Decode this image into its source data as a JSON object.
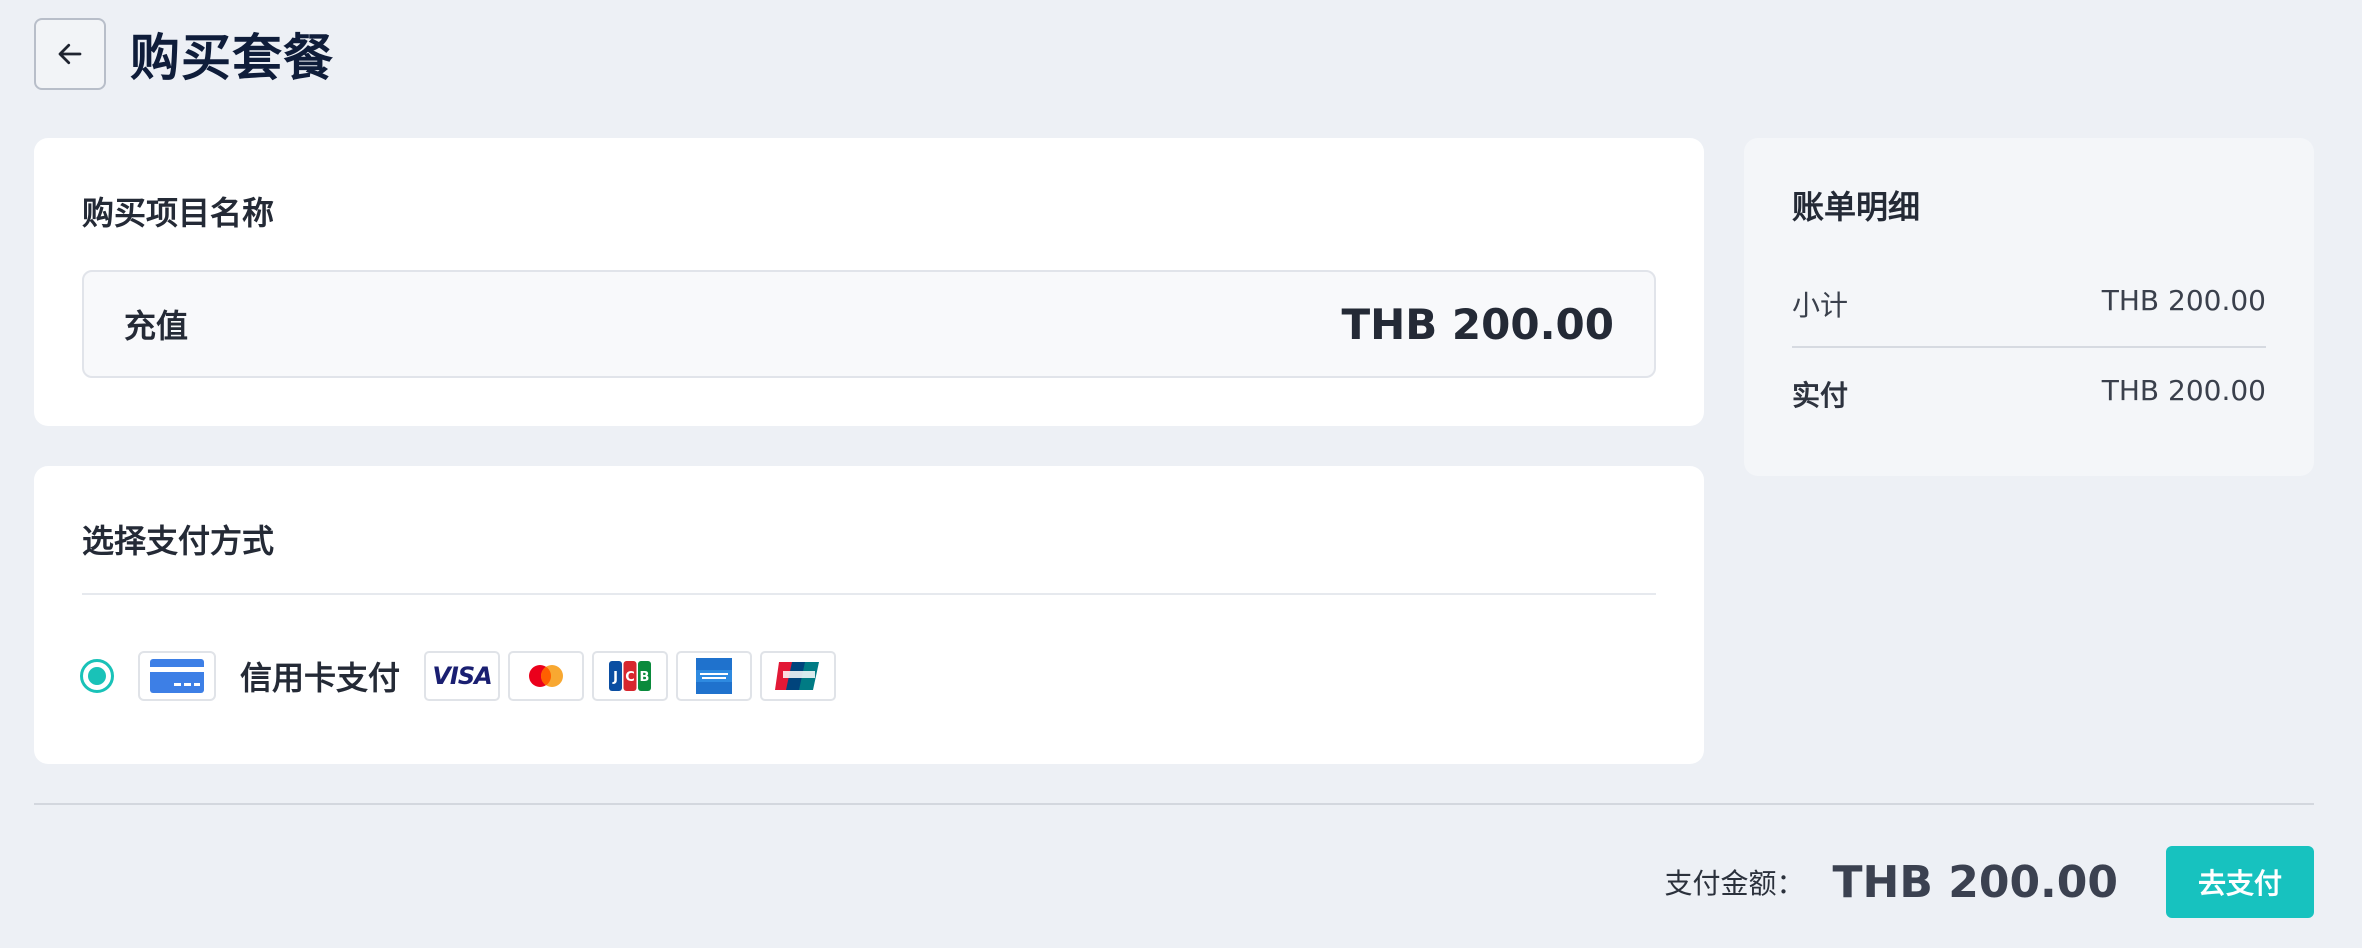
{
  "header": {
    "title": "购买套餐",
    "back_icon": "arrow-left-icon"
  },
  "purchase_item": {
    "section_title": "购买项目名称",
    "name": "充值",
    "price": "THB 200.00"
  },
  "payment": {
    "section_title": "选择支付方式",
    "selected": true,
    "method_label": "信用卡支付",
    "method_icon": "credit-card-icon",
    "brands": [
      {
        "name": "VISA",
        "icon": "visa-icon"
      },
      {
        "name": "Mastercard",
        "icon": "mastercard-icon"
      },
      {
        "name": "JCB",
        "icon": "jcb-icon"
      },
      {
        "name": "American Express",
        "icon": "amex-icon"
      },
      {
        "name": "UnionPay",
        "icon": "unionpay-icon"
      }
    ]
  },
  "bill": {
    "title": "账单明细",
    "subtotal_label": "小计",
    "subtotal": "THB 200.00",
    "paid_label": "实付",
    "paid": "THB 200.00"
  },
  "footer": {
    "amount_label": "支付金额：",
    "amount": "THB 200.00",
    "pay_button": "去支付"
  },
  "colors": {
    "accent": "#17c2bf",
    "background": "#edf0f5",
    "title": "#0f1d3a"
  }
}
